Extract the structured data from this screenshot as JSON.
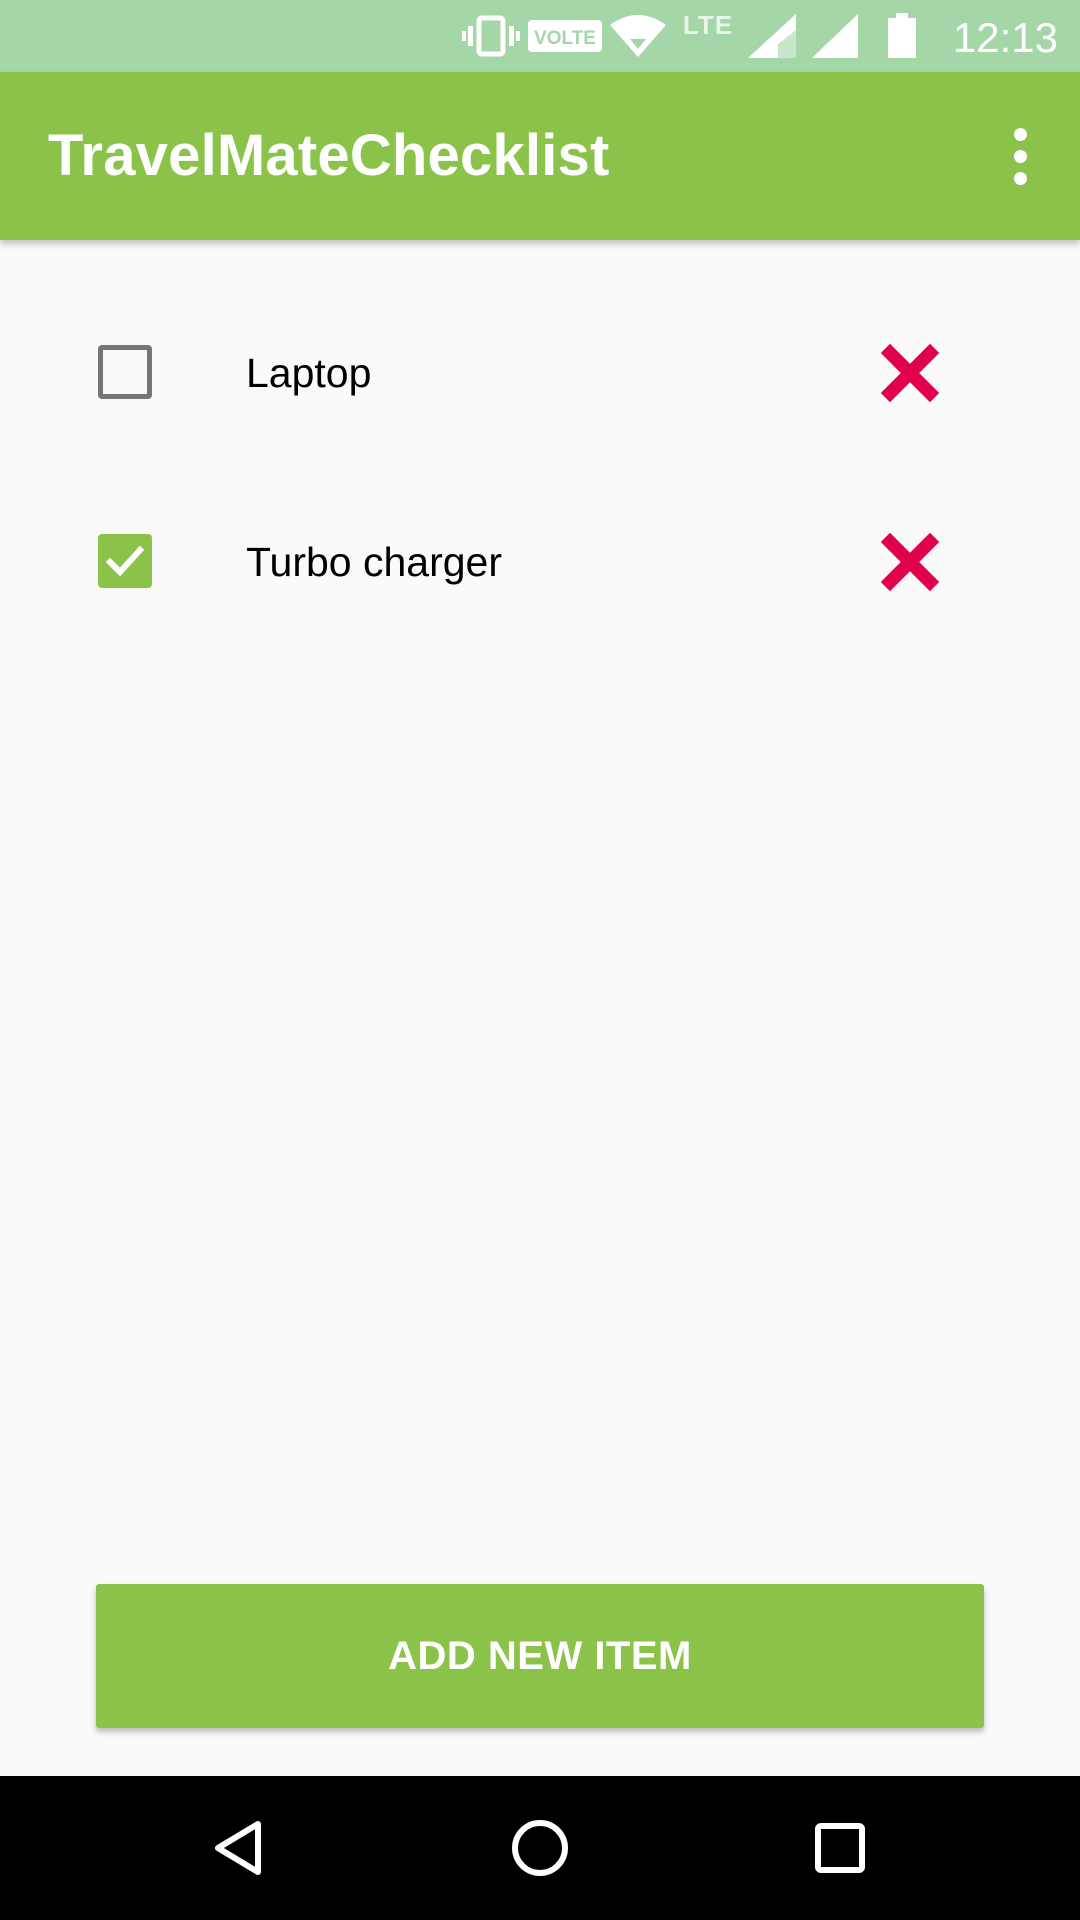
{
  "status_bar": {
    "icons": [
      "vibrate-icon",
      "volte-icon",
      "wifi-icon",
      "lte-icon",
      "signal-icon",
      "signal-icon",
      "battery-icon"
    ],
    "volte_text": "VOLTE",
    "lte_text": "LTE",
    "time": "12:13"
  },
  "app_bar": {
    "title": "TravelMateChecklist",
    "menu_icon": "more-vert-icon"
  },
  "checklist": {
    "items": [
      {
        "label": "Laptop",
        "checked": false,
        "delete_icon": "close-icon"
      },
      {
        "label": "Turbo charger",
        "checked": true,
        "delete_icon": "close-icon"
      }
    ]
  },
  "add_button": {
    "label": "ADD NEW ITEM"
  },
  "nav_bar": {
    "icons": [
      "back-icon",
      "home-icon",
      "recents-icon"
    ]
  },
  "colors": {
    "primary": "#8BC34A",
    "status_bar": "#A5D6A7",
    "delete": "#E0004D",
    "background": "#FAFAFA",
    "checkbox_border": "#757575"
  }
}
